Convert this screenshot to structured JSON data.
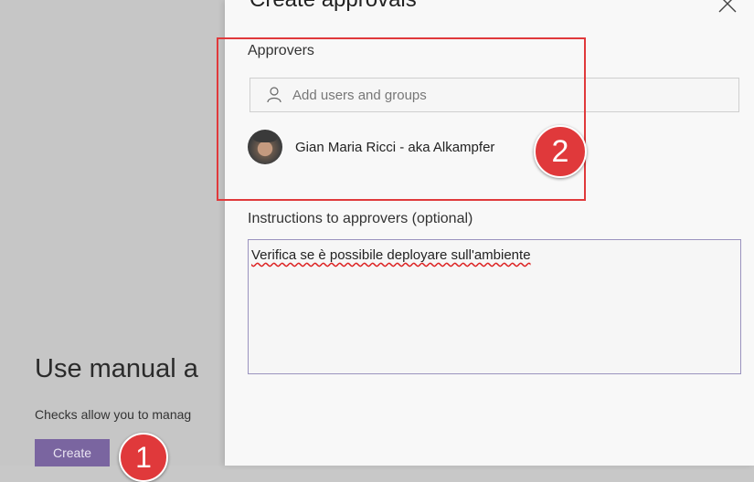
{
  "background_page": {
    "heading": "Use manual a",
    "description": "Checks allow you to manag",
    "create_button": "Create"
  },
  "markers": [
    "1",
    "2"
  ],
  "dialog": {
    "title": "Create approvals",
    "approvers_label": "Approvers",
    "search_placeholder": "Add users and groups",
    "approvers": [
      {
        "name": "Gian Maria Ricci - aka Alkampfer"
      }
    ],
    "instructions_label": "Instructions to approvers (optional)",
    "instructions_value": "Verifica se è possibile deployare sull'ambiente"
  },
  "colors": {
    "accent": "#7a65a0",
    "marker": "#e0393b",
    "highlight_border": "#e0393b"
  }
}
